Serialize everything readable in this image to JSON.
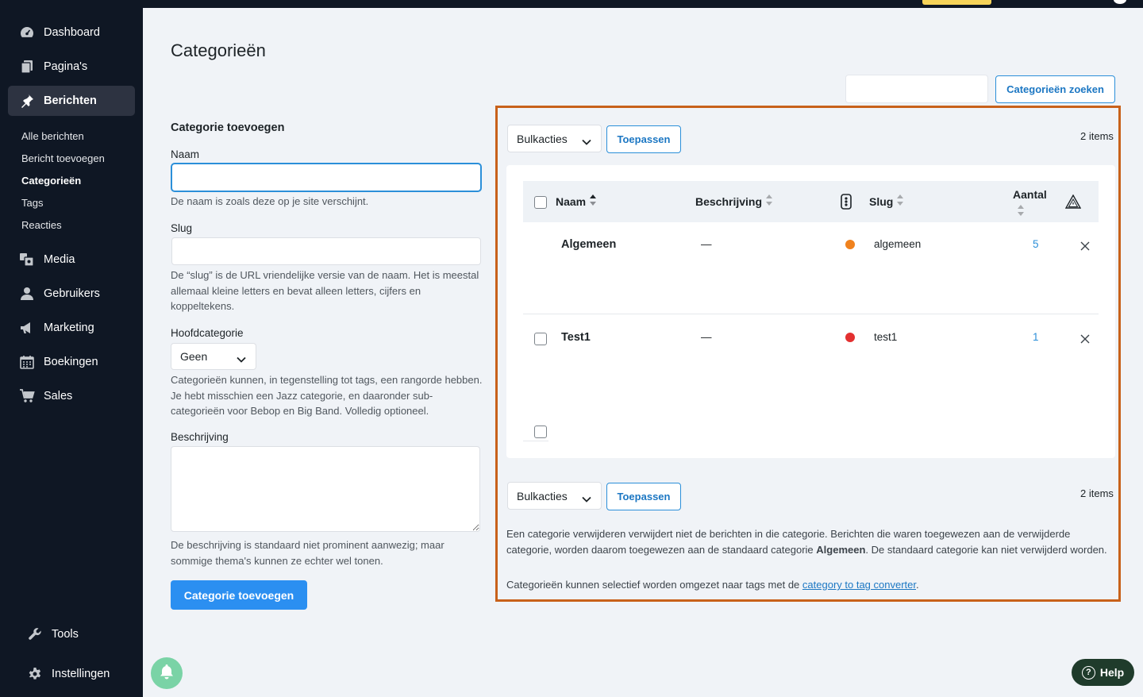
{
  "sidebar": {
    "items": [
      {
        "label": "Dashboard",
        "icon": "dashboard-icon"
      },
      {
        "label": "Pagina's",
        "icon": "pages-icon"
      },
      {
        "label": "Berichten",
        "icon": "pin-icon",
        "active": true
      },
      {
        "label": "Media",
        "icon": "media-icon"
      },
      {
        "label": "Gebruikers",
        "icon": "user-icon"
      },
      {
        "label": "Marketing",
        "icon": "megaphone-icon"
      },
      {
        "label": "Boekingen",
        "icon": "calendar-icon"
      },
      {
        "label": "Sales",
        "icon": "cart-icon"
      },
      {
        "label": "Tools",
        "icon": "wrench-icon"
      },
      {
        "label": "Instellingen",
        "icon": "gear-icon"
      }
    ],
    "submenu": [
      "Alle berichten",
      "Bericht toevoegen",
      "Categorieën",
      "Tags",
      "Reacties"
    ],
    "submenu_current": "Categorieën"
  },
  "page": {
    "title": "Categorieën",
    "search_button": "Categorieën zoeken"
  },
  "add_form": {
    "title": "Categorie toevoegen",
    "name_label": "Naam",
    "name_value": "",
    "name_help": "De naam is zoals deze op je site verschijnt.",
    "slug_label": "Slug",
    "slug_value": "",
    "slug_help": "De “slug” is de URL vriendelijke versie van de naam. Het is meestal allemaal kleine letters en bevat alleen letters, cijfers en koppeltekens.",
    "parent_label": "Hoofdcategorie",
    "parent_value": "Geen",
    "parent_help": "Categorieën kunnen, in tegenstelling tot tags, een rangorde hebben. Je hebt misschien een Jazz categorie, en daaronder sub-categorieën voor Bebop en Big Band. Volledig optioneel.",
    "description_label": "Beschrijving",
    "description_value": "",
    "description_help": "De beschrijving is standaard niet prominent aanwezig; maar sommige thema's kunnen ze echter wel tonen.",
    "submit_label": "Categorie toevoegen"
  },
  "list": {
    "bulk_actions": "Bulkacties",
    "apply_label": "Toepassen",
    "items_count": "2 items",
    "columns": {
      "name": "Naam",
      "description": "Beschrijving",
      "slug": "Slug",
      "count": "Aantal"
    },
    "rows": [
      {
        "name": "Algemeen",
        "description": "—",
        "color": "#f0821e",
        "slug": "algemeen",
        "count": "5",
        "has_checkbox": false
      },
      {
        "name": "Test1",
        "description": "—",
        "color": "#e33030",
        "slug": "test1",
        "count": "1",
        "has_checkbox": true
      }
    ],
    "note_1_pre": "Een categorie verwijderen verwijdert niet de berichten in die categorie. Berichten die waren toegewezen aan de verwijderde categorie, worden daarom toegewezen aan de standaard categorie",
    "note_1_bold": "Algemeen",
    "note_1_post": ". De standaard categorie kan niet verwijderd worden.",
    "note_2_pre": "Categorieën kunnen selectief worden omgezet naar tags met de",
    "note_2_link": "category to tag converter",
    "note_2_post": "."
  },
  "help_button": "Help",
  "colors": {
    "accent": "#2b8ff1",
    "highlight_frame": "#c8611a",
    "sidebar": "#0f1724"
  }
}
